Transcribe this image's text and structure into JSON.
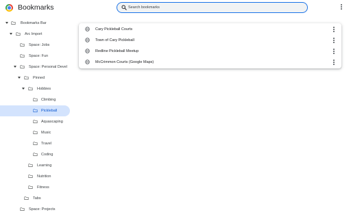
{
  "header": {
    "title": "Bookmarks",
    "search_placeholder": "Search bookmarks",
    "accent": "#1a73e8"
  },
  "tree": [
    {
      "label": "Bookmarks Bar",
      "expanded": true
    },
    {
      "label": "Arc Import",
      "expanded": true
    },
    {
      "label": "Space: Jobs"
    },
    {
      "label": "Space: Fun"
    },
    {
      "label": "Space: Personal Devel",
      "expanded": true
    },
    {
      "label": "Pinned",
      "expanded": true
    },
    {
      "label": "Hobbies",
      "expanded": true
    },
    {
      "label": "Climbing"
    },
    {
      "label": "Pickleball",
      "selected": true
    },
    {
      "label": "Aquascaping"
    },
    {
      "label": "Music"
    },
    {
      "label": "Travel"
    },
    {
      "label": "Coding"
    },
    {
      "label": "Learning"
    },
    {
      "label": "Nutrition"
    },
    {
      "label": "Fitness"
    },
    {
      "label": "Tabs"
    },
    {
      "label": "Space: Projects"
    }
  ],
  "bookmarks": [
    {
      "title": "Cary Pickleball Courts",
      "icon": "globe-icon"
    },
    {
      "title": "Town of Cary Pickleball",
      "icon": "globe-icon"
    },
    {
      "title": "Redline Pickleball Meetup",
      "icon": "globe-icon"
    },
    {
      "title": "McCrimmon Courts (Google Maps)",
      "icon": "globe-icon"
    }
  ]
}
